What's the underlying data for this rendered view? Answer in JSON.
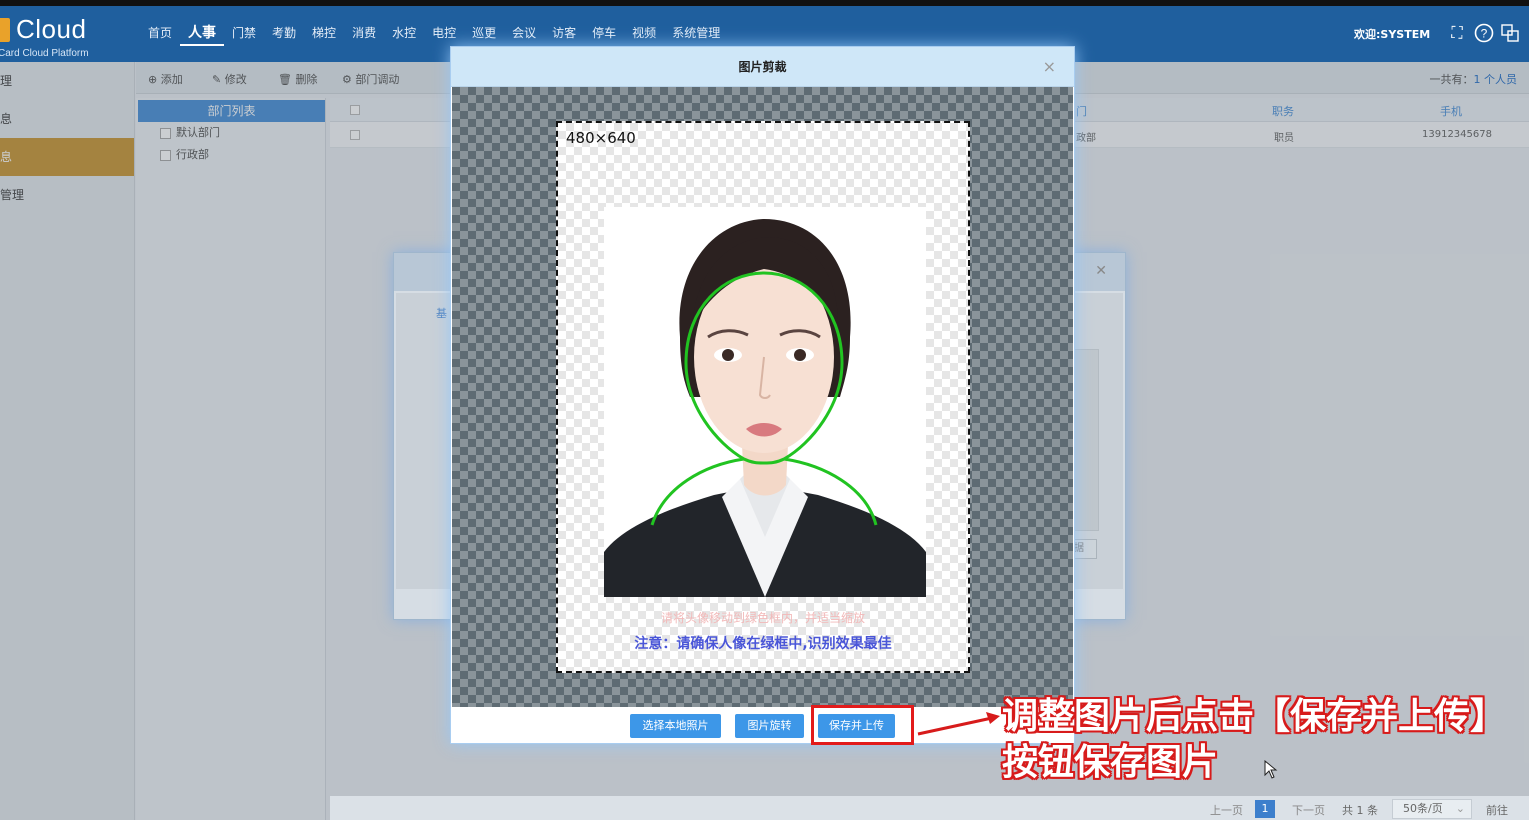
{
  "header": {
    "logo_title": "Cloud",
    "logo_sub": "Card Cloud Platform",
    "nav": [
      "首页",
      "人事",
      "门禁",
      "考勤",
      "梯控",
      "消费",
      "水控",
      "电控",
      "巡更",
      "会议",
      "访客",
      "停车",
      "视频",
      "系统管理"
    ],
    "active_nav": "人事",
    "welcome": "欢迎:SYSTEM"
  },
  "sidebar": {
    "items": [
      "理",
      "息",
      "息",
      "管理"
    ],
    "active_index": 2
  },
  "toolbar": {
    "add": "⊕ 添加",
    "edit": "✎ 修改",
    "delete": "🗑 删除",
    "move": "⚙ 部门调动",
    "total_prefix": "一共有：",
    "total_value": "1 个人员"
  },
  "dept": {
    "header": "部门列表",
    "items": [
      "默认部门",
      "行政部"
    ]
  },
  "table": {
    "col_dept_partial": "门",
    "col_position": "职务",
    "col_phone": "手机",
    "row": {
      "dept_partial": "政部",
      "position": "职员",
      "phone": "13912345678"
    }
  },
  "bg_dialog": {
    "tab_partial": "基",
    "btn_partial": "据"
  },
  "crop_dialog": {
    "title": "图片剪裁",
    "close": "×",
    "size_label": "480×640",
    "note_faint": "请将头像移动到绿色框内，并适当缩放",
    "note": "注意：请确保人像在绿框中,识别效果最佳",
    "btn_choose": "选择本地照片",
    "btn_rotate": "图片旋转",
    "btn_save": "保存并上传"
  },
  "annotation": {
    "line1": "调整图片后点击【保存并上传】",
    "line2": "按钮保存图片",
    "color": "#d71b1b"
  },
  "pager": {
    "prev": "上一页",
    "current": "1",
    "next": "下一页",
    "total": "共 1 条",
    "page_size": "50条/页",
    "goto": "前往"
  }
}
